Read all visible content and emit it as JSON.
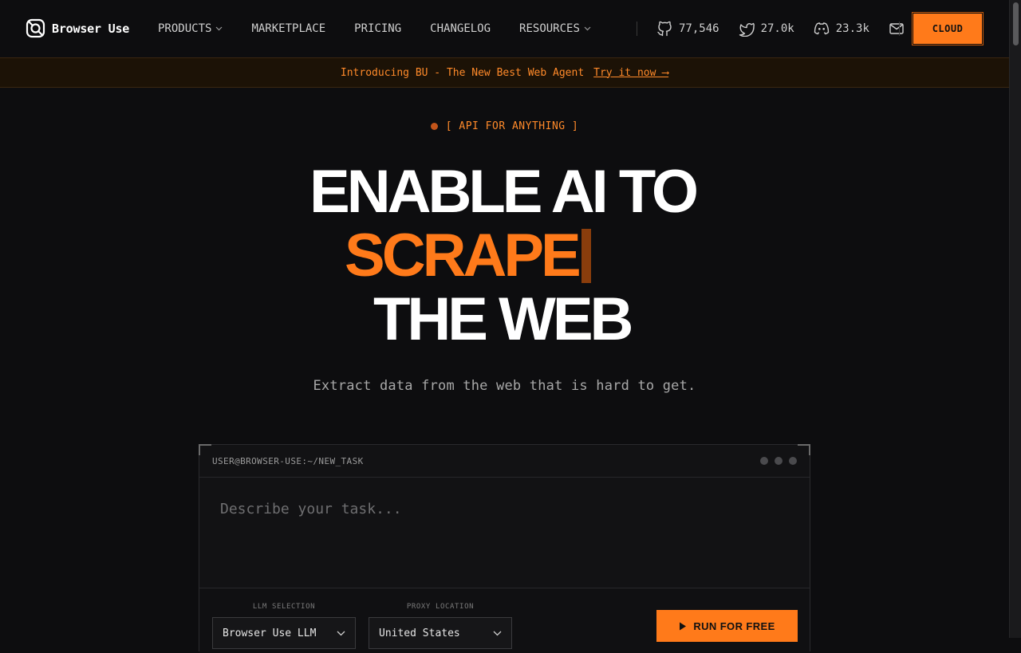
{
  "nav": {
    "brand": "Browser Use",
    "links": [
      {
        "label": "PRODUCTS",
        "has_dropdown": true
      },
      {
        "label": "MARKETPLACE",
        "has_dropdown": false
      },
      {
        "label": "PRICING",
        "has_dropdown": false
      },
      {
        "label": "CHANGELOG",
        "has_dropdown": false
      },
      {
        "label": "RESOURCES",
        "has_dropdown": true
      }
    ],
    "stats": {
      "github": "77,546",
      "twitter": "27.0k",
      "discord": "23.3k"
    },
    "cta": "CLOUD"
  },
  "announcement": {
    "text": "Introducing BU - The New Best Web Agent",
    "link": "Try it now ⟶"
  },
  "hero": {
    "eyebrow": "[ API FOR ANYTHING ]",
    "line1": "ENABLE AI TO",
    "line2": "SCRAPE",
    "line3": "THE WEB",
    "subtitle": "Extract data from the web that is hard to get."
  },
  "terminal": {
    "path": "USER@BROWSER-USE:~/NEW_TASK",
    "placeholder": "Describe your task...",
    "llm_label": "LLM SELECTION",
    "llm_value": "Browser Use LLM",
    "proxy_label": "PROXY LOCATION",
    "proxy_value": "United States",
    "run_label": "RUN FOR FREE"
  },
  "colors": {
    "background": "#0d0d0f",
    "accent": "#ff7a1a",
    "announce_bg": "#1c1206"
  }
}
